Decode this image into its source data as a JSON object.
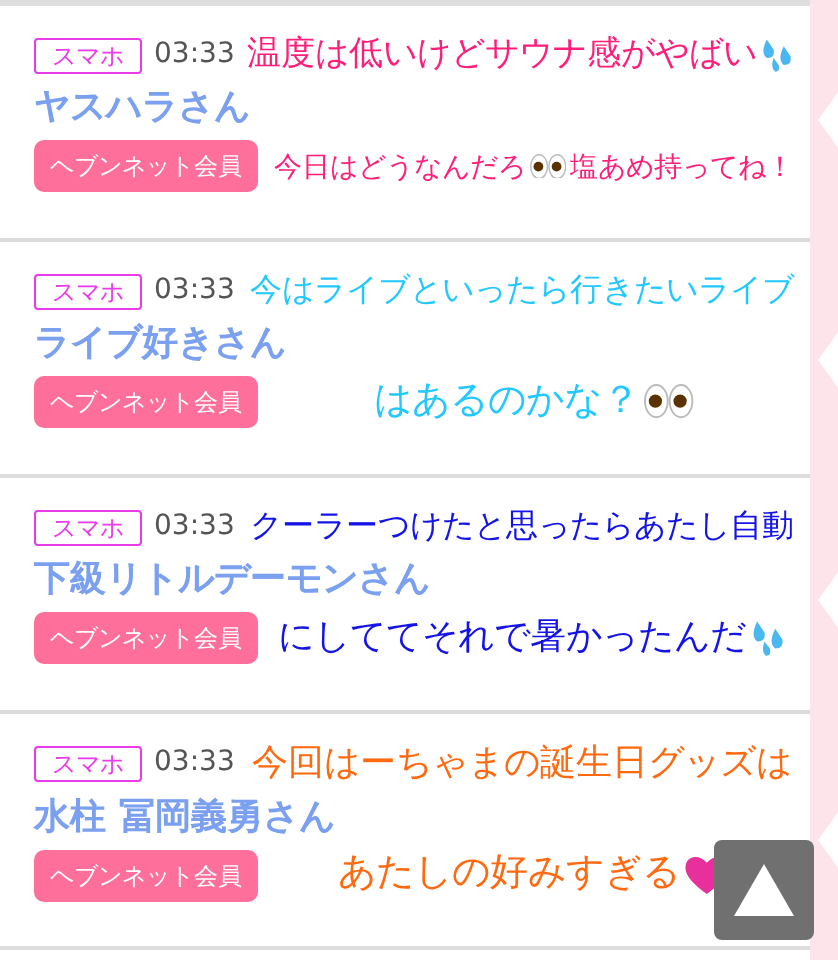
{
  "posts": [
    {
      "device": "スマホ",
      "time": "03:33",
      "name": "ヤスハラさん",
      "member_button": "ヘブンネット会員",
      "comment": {
        "color": "#ff1f7a",
        "lines": [
          [
            {
              "kind": "text",
              "text": "温度は低いけどサウナ感がやばい"
            },
            {
              "kind": "sweat"
            }
          ],
          [
            {
              "kind": "text",
              "text": "今日はどうなんだろ"
            },
            {
              "kind": "eyes"
            },
            {
              "kind": "text",
              "text": "塩あめ持ってね！"
            }
          ]
        ]
      }
    },
    {
      "device": "スマホ",
      "time": "03:33",
      "name": "ライブ好きさん",
      "member_button": "ヘブンネット会員",
      "comment": {
        "color": "#22c8ff",
        "lines": [
          [
            {
              "kind": "text",
              "text": "今はライブといったら行きたいライブ"
            }
          ],
          [
            {
              "kind": "text",
              "text": "はあるのかな？"
            },
            {
              "kind": "eyes"
            }
          ]
        ]
      }
    },
    {
      "device": "スマホ",
      "time": "03:33",
      "name": "下級リトルデーモンさん",
      "member_button": "ヘブンネット会員",
      "comment": {
        "color": "#1414e6",
        "lines": [
          [
            {
              "kind": "text",
              "text": "クーラーつけたと思ったらあたし自動"
            }
          ],
          [
            {
              "kind": "text",
              "text": "にしててそれで暑かったんだ"
            },
            {
              "kind": "sweat"
            }
          ]
        ]
      }
    },
    {
      "device": "スマホ",
      "time": "03:33",
      "name": "水柱 冨岡義勇さん",
      "member_button": "ヘブンネット会員",
      "comment": {
        "color": "#ff6a10",
        "lines": [
          [
            {
              "kind": "text",
              "text": "今回はーちゃまの誕生日グッズは"
            }
          ],
          [
            {
              "kind": "text",
              "text": "あたしの好みすぎる"
            },
            {
              "kind": "heart"
            }
          ]
        ]
      }
    }
  ],
  "scroll_top_button": {
    "kind": "up"
  }
}
